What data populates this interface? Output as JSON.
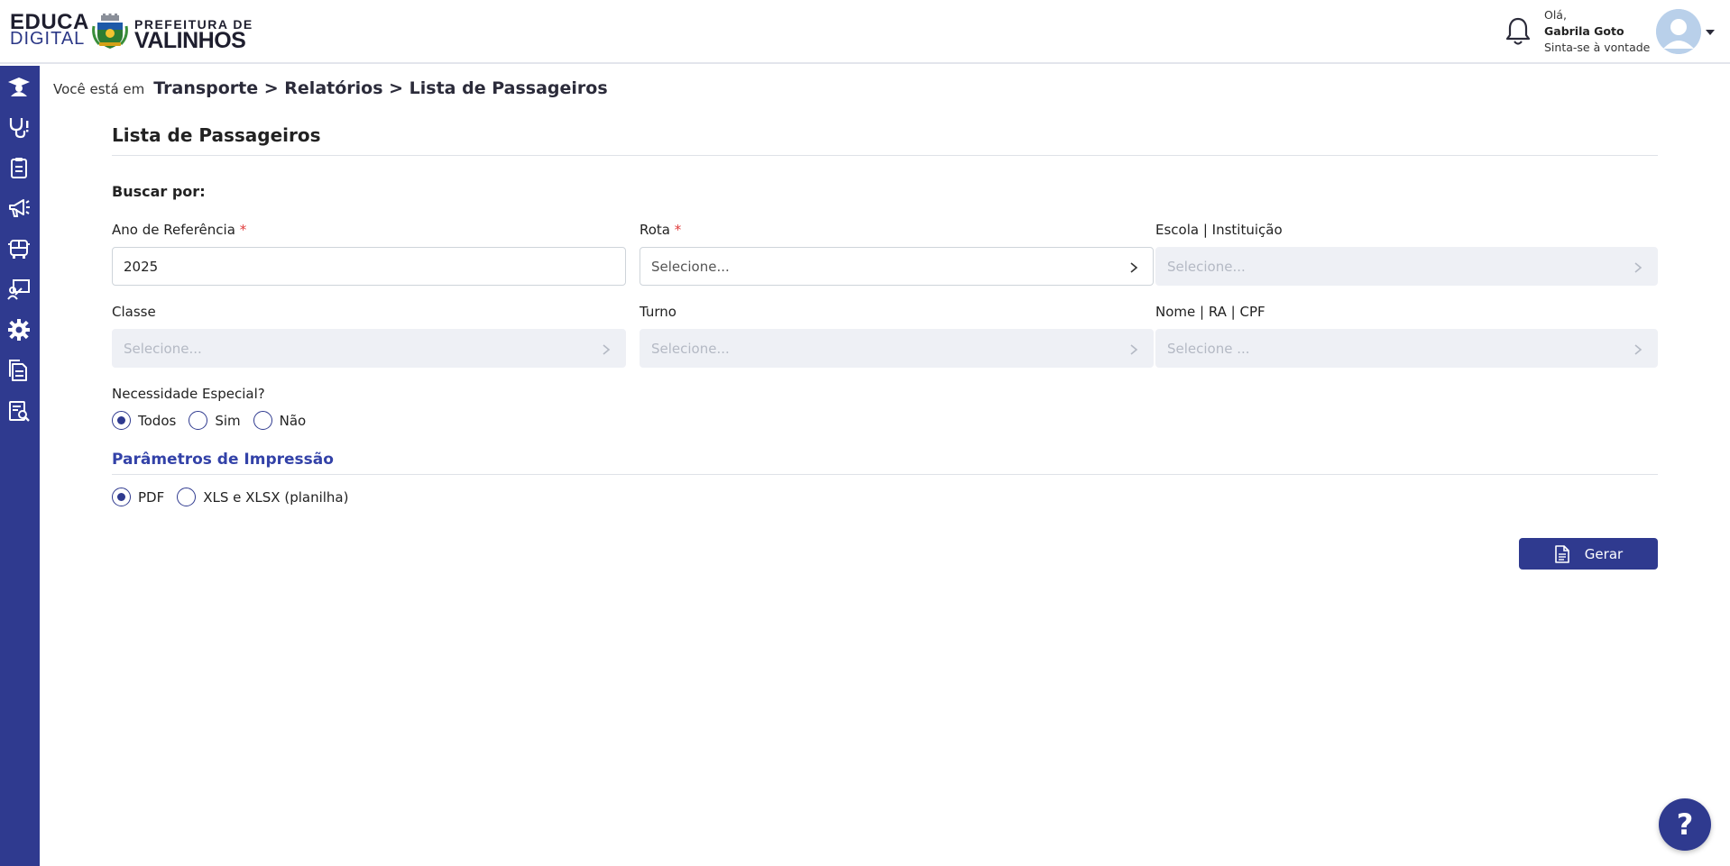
{
  "header": {
    "logo_educa_line1": "EDUCA",
    "logo_educa_line2": "DIGITAL",
    "logo_prefeitura_line1": "PREFEITURA DE",
    "logo_prefeitura_line2": "VALINHOS",
    "greeting": "Olá,",
    "user_name": "Gabrila Goto",
    "user_subtitle": "Sinta-se à vontade"
  },
  "sidebar": {
    "items": [
      {
        "icon": "graduation-cap-icon"
      },
      {
        "icon": "stethoscope-icon"
      },
      {
        "icon": "clipboard-icon"
      },
      {
        "icon": "megaphone-icon"
      },
      {
        "icon": "bus-icon"
      },
      {
        "icon": "teacher-board-icon"
      },
      {
        "icon": "gear-icon"
      },
      {
        "icon": "documents-icon"
      },
      {
        "icon": "report-search-icon"
      }
    ]
  },
  "breadcrumb": {
    "prefix": "Você está em",
    "path": "Transporte > Relatórios > Lista de Passageiros"
  },
  "page": {
    "title": "Lista de Passageiros",
    "search_by": "Buscar por:"
  },
  "form": {
    "ano_label": "Ano de Referência",
    "ano_value": "2025",
    "rota_label": "Rota",
    "rota_placeholder": "Selecione...",
    "escola_label": "Escola | Instituição",
    "escola_placeholder": "Selecione...",
    "classe_label": "Classe",
    "classe_placeholder": "Selecione...",
    "turno_label": "Turno",
    "turno_placeholder": "Selecione...",
    "nome_label": "Nome | RA | CPF",
    "nome_placeholder": "Selecione ...",
    "required_mark": "*",
    "necessidade_label": "Necessidade Especial?",
    "necessidade_options": [
      "Todos",
      "Sim",
      "Não"
    ],
    "necessidade_selected": "Todos"
  },
  "print": {
    "section_title": "Parâmetros de Impressão",
    "options": [
      "PDF",
      "XLS e XLSX (planilha)"
    ],
    "selected": "PDF"
  },
  "actions": {
    "gerar_label": "Gerar",
    "help_label": "?"
  },
  "colors": {
    "primary": "#2f3a8f",
    "section_title": "#3342a8",
    "required": "#e03b3b",
    "disabled_field": "#eef0f5"
  }
}
